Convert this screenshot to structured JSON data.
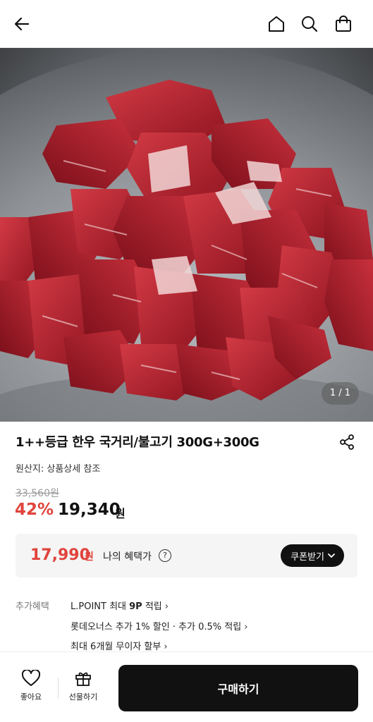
{
  "header": {
    "back_icon": "arrow-left-icon",
    "home_icon": "home-icon",
    "search_icon": "search-icon",
    "cart_icon": "shopping-bag-icon"
  },
  "gallery": {
    "counter": "1 / 1"
  },
  "product": {
    "title": "1++등급 한우 국거리/불고기 300G+300G",
    "origin": "원산지: 상품상세 참조",
    "original_price": "33,560원",
    "discount": "42%",
    "price": "19,340",
    "price_unit": "원"
  },
  "benefit": {
    "price": "17,990",
    "unit": "원",
    "label": "나의 혜택가",
    "help": "?",
    "coupon_button": "쿠폰받기"
  },
  "extra": {
    "label": "추가혜택",
    "line1_prefix": "L.POINT 최대 ",
    "line1_bold": "9P",
    "line1_suffix": " 적립",
    "line2": "롯데오너스 추가 1% 할인 · 추가 0.5% 적립",
    "line3": "최대 6개월 무이자 할부",
    "chevron": "›"
  },
  "bottom": {
    "like_label": "좋아요",
    "gift_label": "선물하기",
    "buy_label": "구매하기"
  },
  "colors": {
    "accent_red": "#e0443c",
    "dark": "#111111"
  }
}
